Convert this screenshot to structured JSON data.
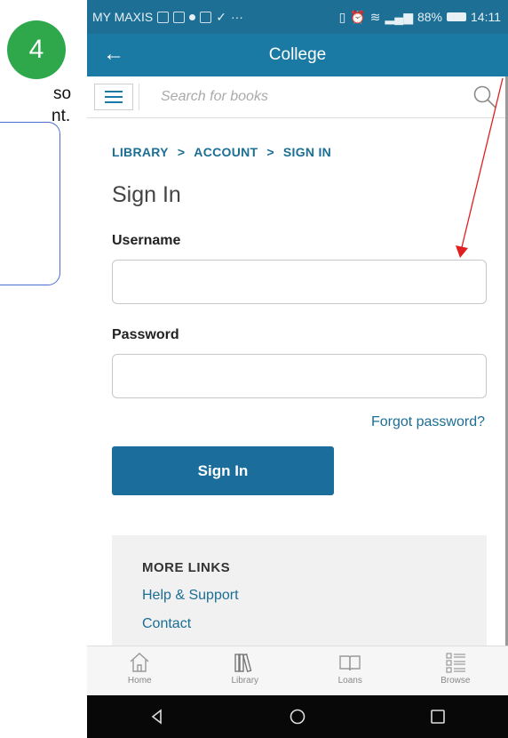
{
  "overlay": {
    "step_number": "4",
    "side_text_line1": "so",
    "side_text_line2": "nt."
  },
  "status_bar": {
    "carrier": "MY MAXIS",
    "battery": "88%",
    "time": "14:11"
  },
  "app_bar": {
    "title": "College"
  },
  "search": {
    "placeholder": "Search for books"
  },
  "breadcrumb": [
    "LIBRARY",
    ">",
    "ACCOUNT",
    ">",
    "SIGN IN"
  ],
  "page_title": "Sign In",
  "form": {
    "username_label": "Username",
    "username_value": "",
    "password_label": "Password",
    "password_value": "",
    "forgot_label": "Forgot password?",
    "submit_label": "Sign In"
  },
  "more_links": {
    "title": "MORE LINKS",
    "links": [
      "Help & Support",
      "Contact"
    ]
  },
  "tabs": [
    {
      "label": "Home",
      "icon": "home-icon"
    },
    {
      "label": "Library",
      "icon": "library-icon"
    },
    {
      "label": "Loans",
      "icon": "book-icon"
    },
    {
      "label": "Browse",
      "icon": "browse-icon"
    }
  ],
  "colors": {
    "app_bar": "#1b7aa3",
    "accent": "#1b6e94",
    "step_badge": "#2ea84a",
    "annotation_arrow": "#e02020"
  }
}
